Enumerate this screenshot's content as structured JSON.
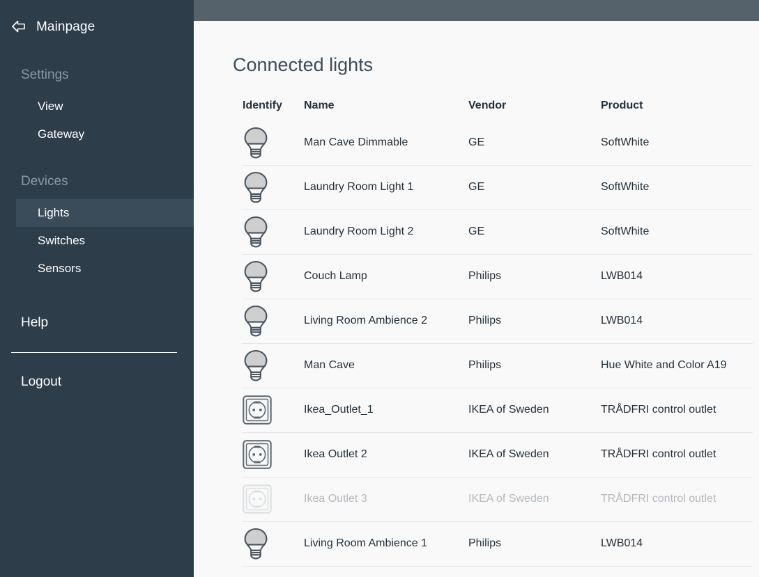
{
  "sidebar": {
    "brand": {
      "label": "Mainpage",
      "back_icon": "back-arrow-icon"
    },
    "groups": [
      {
        "title": "Settings",
        "items": [
          {
            "label": "View",
            "active": false
          },
          {
            "label": "Gateway",
            "active": false
          }
        ]
      },
      {
        "title": "Devices",
        "items": [
          {
            "label": "Lights",
            "active": true
          },
          {
            "label": "Switches",
            "active": false
          },
          {
            "label": "Sensors",
            "active": false
          }
        ]
      }
    ],
    "help_label": "Help",
    "logout_label": "Logout"
  },
  "main": {
    "page_title": "Connected lights",
    "table": {
      "headers": {
        "identify": "Identify",
        "name": "Name",
        "vendor": "Vendor",
        "product": "Product"
      },
      "rows": [
        {
          "icon": "light-bulb-icon",
          "name": "Man Cave Dimmable",
          "vendor": "GE",
          "product": "SoftWhite",
          "disabled": false
        },
        {
          "icon": "light-bulb-icon",
          "name": "Laundry Room Light 1",
          "vendor": "GE",
          "product": "SoftWhite",
          "disabled": false
        },
        {
          "icon": "light-bulb-icon",
          "name": "Laundry Room Light 2",
          "vendor": "GE",
          "product": "SoftWhite",
          "disabled": false
        },
        {
          "icon": "light-bulb-icon",
          "name": "Couch Lamp",
          "vendor": "Philips",
          "product": "LWB014",
          "disabled": false
        },
        {
          "icon": "light-bulb-icon",
          "name": "Living Room Ambience 2",
          "vendor": "Philips",
          "product": "LWB014",
          "disabled": false
        },
        {
          "icon": "light-bulb-icon",
          "name": "Man Cave",
          "vendor": "Philips",
          "product": "Hue White and Color A19",
          "disabled": false
        },
        {
          "icon": "power-outlet-icon",
          "name": "Ikea_Outlet_1",
          "vendor": "IKEA of Sweden",
          "product": "TRÅDFRI control outlet",
          "disabled": false
        },
        {
          "icon": "power-outlet-icon",
          "name": "Ikea Outlet 2",
          "vendor": "IKEA of Sweden",
          "product": "TRÅDFRI control outlet",
          "disabled": false
        },
        {
          "icon": "power-outlet-icon",
          "name": "Ikea Outlet 3",
          "vendor": "IKEA of Sweden",
          "product": "TRÅDFRI control outlet",
          "disabled": true
        },
        {
          "icon": "light-bulb-icon",
          "name": "Living Room Ambience 1",
          "vendor": "Philips",
          "product": "LWB014",
          "disabled": false
        }
      ]
    }
  },
  "colors": {
    "sidebar_bg": "#2e3d4a",
    "sidebar_active_bg": "#3a4b59",
    "topbar_bg": "#55626c",
    "main_bg": "#f9f9f9",
    "text_dark": "#24313c",
    "text_muted": "#8d99a3",
    "text_disabled": "#b4b9bd",
    "row_divider": "#e6e6e6"
  }
}
